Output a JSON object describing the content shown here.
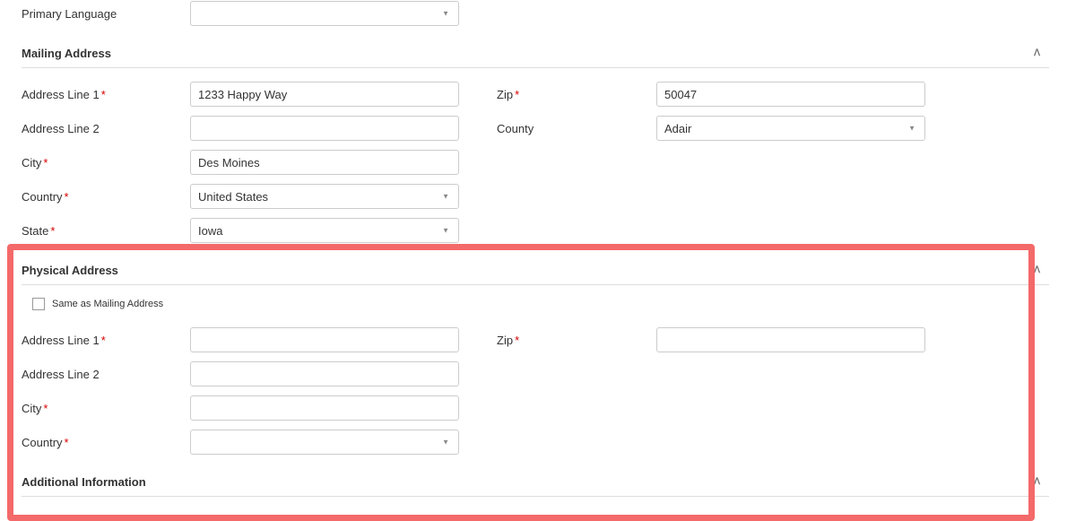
{
  "top": {
    "primary_language_label": "Primary Language",
    "primary_language_value": ""
  },
  "sections": {
    "mailing": {
      "title": "Mailing Address",
      "caret": "ᐱ",
      "fields": {
        "address1_label": "Address Line 1",
        "address1_value": "1233 Happy Way",
        "address2_label": "Address Line 2",
        "address2_value": "",
        "city_label": "City",
        "city_value": "Des Moines",
        "country_label": "Country",
        "country_value": "United States",
        "state_label": "State",
        "state_value": "Iowa",
        "zip_label": "Zip",
        "zip_value": "50047",
        "county_label": "County",
        "county_value": "Adair"
      }
    },
    "physical": {
      "title": "Physical Address",
      "caret": "ᐱ",
      "same_as_label": "Same as Mailing Address",
      "fields": {
        "address1_label": "Address Line 1",
        "address1_value": "",
        "address2_label": "Address Line 2",
        "address2_value": "",
        "city_label": "City",
        "city_value": "",
        "country_label": "Country",
        "country_value": "",
        "zip_label": "Zip",
        "zip_value": ""
      }
    },
    "additional": {
      "title": "Additional Information",
      "caret": "ᐱ"
    }
  },
  "req": "*"
}
